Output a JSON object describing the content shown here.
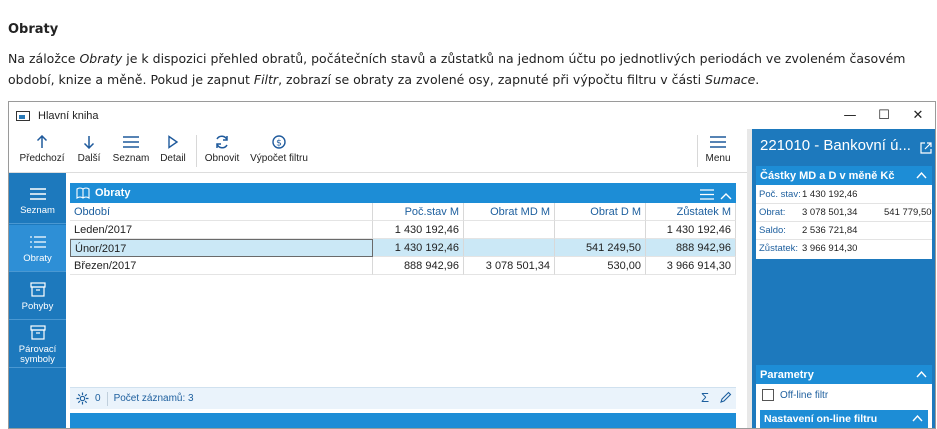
{
  "doc": {
    "heading": "Obraty",
    "para": {
      "p1": "Na záložce ",
      "e1": "Obraty",
      "p2": " je k dispozici přehled obratů, počátečních stavů a zůstatků na jednom účtu po jednotlivých periodách ve zvoleném časovém období, knize a měně. Pokud je zapnut ",
      "e2": "Filtr",
      "p3": ", zobrazí se obraty za zvolené osy, zapnuté při výpočtu filtru v části ",
      "e3": "Sumace",
      "p4": "."
    }
  },
  "window": {
    "title": "Hlavní kniha",
    "controls": {
      "minimize": "—",
      "maximize": "☐",
      "close": "✕"
    }
  },
  "toolbar": {
    "prev": "Předchozí",
    "next": "Další",
    "list": "Seznam",
    "detail": "Detail",
    "refresh": "Obnovit",
    "filter_calc": "Výpočet filtru",
    "menu": "Menu"
  },
  "sidenav": {
    "items": [
      {
        "label": "Seznam"
      },
      {
        "label": "Obraty"
      },
      {
        "label": "Pohyby"
      },
      {
        "label": "Párovací symboly"
      }
    ]
  },
  "panel": {
    "title": "Obraty",
    "columns": [
      "Období",
      "Poč.stav M",
      "Obrat MD M",
      "Obrat D M",
      "Zůstatek M"
    ],
    "rows": [
      [
        "Leden/2017",
        "1 430 192,46",
        "",
        "",
        "1 430 192,46"
      ],
      [
        "Únor/2017",
        "1 430 192,46",
        "",
        "541 249,50",
        "888 942,96"
      ],
      [
        "Březen/2017",
        "888 942,96",
        "3 078 501,34",
        "530,00",
        "3 966 914,30"
      ]
    ],
    "footer": {
      "filter_count": "0",
      "record_count": "Počet záznamů: 3"
    }
  },
  "right_panel": {
    "account": "221010 - Bankovní ú...",
    "amounts": {
      "heading": "Částky MD a D v měně Kč",
      "poc_stav_label": "Poč. stav:",
      "poc_stav_value": "1 430 192,46",
      "obrat_label": "Obrat:",
      "obrat_md": "3 078 501,34",
      "obrat_d": "541 779,50",
      "saldo_label": "Saldo:",
      "saldo_value": "2 536 721,84",
      "zustatek_label": "Zůstatek:",
      "zustatek_value": "3 966 914,30"
    },
    "params": {
      "heading": "Parametry",
      "offline_filter": "Off-line filtr",
      "online_settings": "Nastavení on-line filtru"
    }
  },
  "colors": {
    "accent": "#1d79bd",
    "header_blue": "#1d8dd6",
    "selection": "#cbe8f6"
  }
}
